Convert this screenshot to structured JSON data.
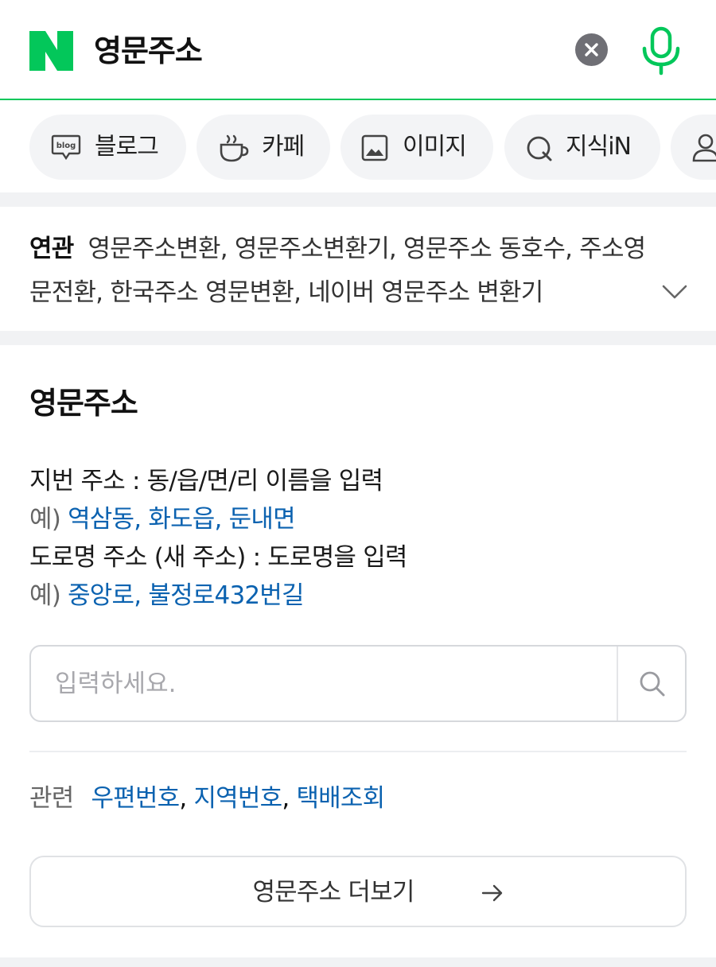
{
  "header": {
    "logo_letter": "N",
    "query": "영문주소",
    "brand_color": "#03c75a"
  },
  "tabs": [
    {
      "label": "블로그",
      "icon": "blog-icon"
    },
    {
      "label": "카페",
      "icon": "cafe-cup-icon"
    },
    {
      "label": "이미지",
      "icon": "image-icon"
    },
    {
      "label": "지식iN",
      "icon": "knowledge-q-icon"
    },
    {
      "label": "",
      "icon": "person-icon"
    }
  ],
  "related": {
    "label": "연관",
    "text": "영문주소변환, 영문주소변환기, 영문주소 동호수, 주소영문전환, 한국주소 영문변환, 네이버 영문주소 변환기"
  },
  "card": {
    "title": "영문주소",
    "jibun_desc": "지번 주소 : 동/읍/면/리 이름을 입력",
    "example_prefix": "예)",
    "jibun_examples": [
      "역삼동",
      "화도읍",
      "둔내면"
    ],
    "road_desc": "도로명 주소 (새 주소) : 도로명을 입력",
    "road_examples": [
      "중앙로",
      "불정로432번길"
    ],
    "search_placeholder": "입력하세요.",
    "related_label": "관련",
    "related_links": [
      "우편번호",
      "지역번호",
      "택배조회"
    ],
    "more_label": "영문주소 더보기",
    "link_color": "#0b62b0"
  }
}
